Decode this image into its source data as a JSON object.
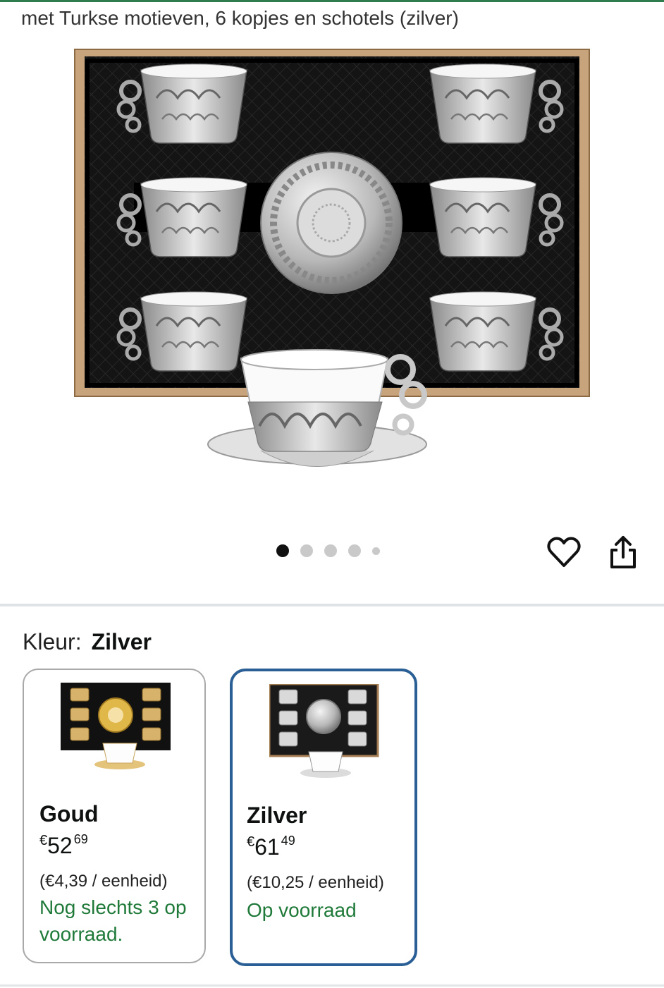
{
  "product": {
    "title": "met Turkse motieven, 6 kopjes en schotels (zilver)"
  },
  "gallery": {
    "image_alt": "product-image-silver-cup-set",
    "total_images": 5,
    "active_index": 1
  },
  "actions": {
    "wishlist_icon": "heart-icon",
    "share_icon": "share-icon"
  },
  "variant": {
    "label": "Kleur:",
    "selected": "Zilver",
    "options": [
      {
        "name": "Goud",
        "currency": "€",
        "price_whole": "52",
        "price_cents": "69",
        "unit_price": "(€4,39 / eenheid)",
        "stock": "Nog slechts 3 op voorraad.",
        "selected": false
      },
      {
        "name": "Zilver",
        "currency": "€",
        "price_whole": "61",
        "price_cents": "49",
        "unit_price": "(€10,25 / eenheid)",
        "stock": "Op voorraad",
        "selected": true
      }
    ]
  },
  "colors": {
    "selected_border": "#2a5f95",
    "stock_green": "#1f7a3a",
    "top_accent": "#2e7d4f"
  }
}
